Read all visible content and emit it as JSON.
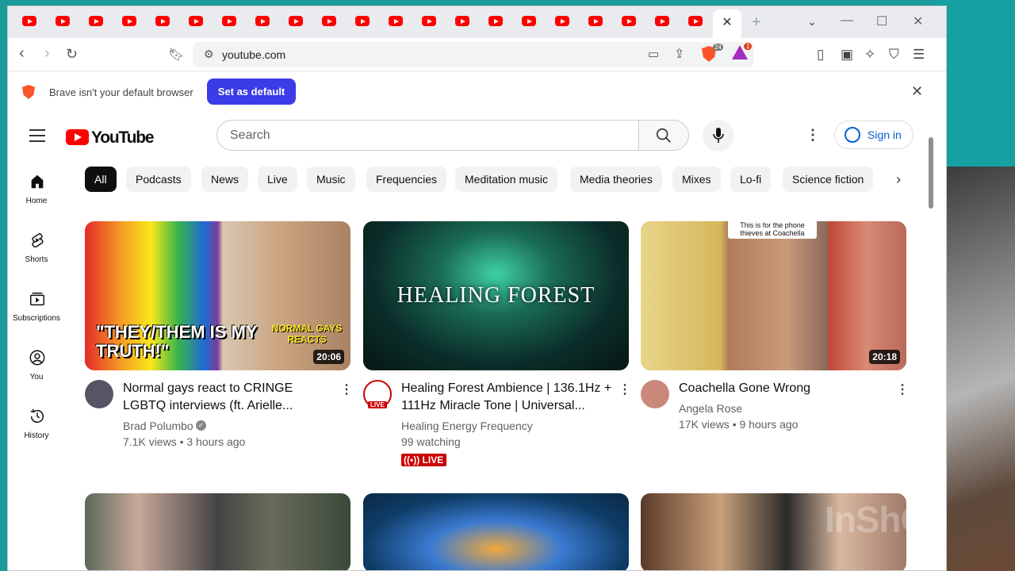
{
  "browser": {
    "tab_count_youtube": 21,
    "close_tab_glyph": "✕",
    "new_tab_glyph": "+",
    "url": "youtube.com",
    "brave_shield_count": "24",
    "brave_rewards_count": "1",
    "accent": "#3b3be8"
  },
  "banner": {
    "text": "Brave isn't your default browser",
    "button_label": "Set as default"
  },
  "youtube": {
    "logo_text": "YouTube",
    "search_placeholder": "Search",
    "sign_in_label": "Sign in",
    "sidebar": [
      {
        "label": "Home",
        "icon": "home-icon"
      },
      {
        "label": "Shorts",
        "icon": "shorts-icon"
      },
      {
        "label": "Subscriptions",
        "icon": "subscriptions-icon"
      },
      {
        "label": "You",
        "icon": "you-icon"
      },
      {
        "label": "History",
        "icon": "history-icon"
      }
    ],
    "chips": [
      "All",
      "Podcasts",
      "News",
      "Live",
      "Music",
      "Frequencies",
      "Meditation music",
      "Media theories",
      "Mixes",
      "Lo-fi",
      "Science fiction"
    ],
    "videos": [
      {
        "title": "Normal gays react to CRINGE LGBTQ interviews (ft. Arielle...",
        "channel": "Brad Polumbo",
        "verified": true,
        "meta": "7.1K views • 3 hours ago",
        "duration": "20:06",
        "thumb_caption": "\"THEY/THEM IS MY TRUTH!\"",
        "thumb_sub": "NORMAL GAYS REACTS"
      },
      {
        "title": "Healing Forest Ambience | 136.1Hz + 111Hz Miracle Tone | Universal...",
        "channel": "Healing Energy Frequency",
        "meta": "99 watching",
        "live_label": "LIVE",
        "avatar_live": "LIVE",
        "thumb_caption": "HEALING FOREST"
      },
      {
        "title": "Coachella Gone Wrong",
        "channel": "Angela Rose",
        "meta": "17K views • 9 hours ago",
        "duration": "20:18",
        "thumb_caption": "This is for the phone thieves at Coachella"
      }
    ]
  },
  "watermark": "InShOt"
}
